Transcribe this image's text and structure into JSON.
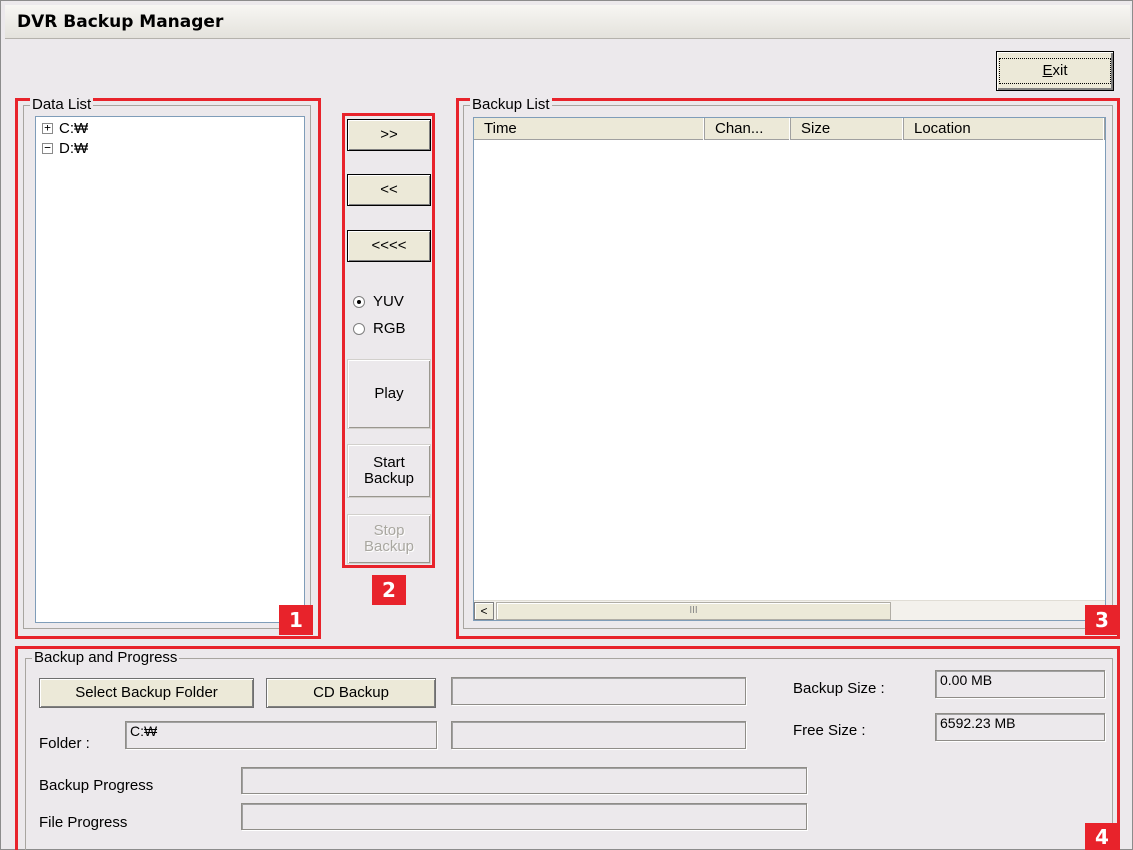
{
  "window": {
    "title": "DVR Backup Manager"
  },
  "exit_button": {
    "label": "Exit"
  },
  "data_list": {
    "legend": "Data List",
    "items": [
      {
        "label": "C:₩",
        "expander": "+"
      },
      {
        "label": "D:₩",
        "expander": "−"
      }
    ]
  },
  "controls": {
    "add_label": ">>",
    "remove_label": "<<",
    "remove_all_label": "<<<<",
    "radio_yuv": "YUV",
    "radio_rgb": "RGB",
    "play_label": "Play",
    "start_backup_line1": "Start",
    "start_backup_line2": "Backup",
    "stop_backup_line1": "Stop",
    "stop_backup_line2": "Backup"
  },
  "backup_list": {
    "legend": "Backup List",
    "columns": [
      "Time",
      "Chan...",
      "Size",
      "Location"
    ],
    "scrollbar_grip": "III",
    "scroll_left": "<"
  },
  "progress": {
    "legend": "Backup and Progress",
    "select_folder_label": "Select Backup Folder",
    "cd_backup_label": "CD Backup",
    "folder_label": "Folder :",
    "folder_value": "C:₩",
    "backup_size_label": "Backup Size :",
    "backup_size_value": "0.00 MB",
    "free_size_label": "Free Size :",
    "free_size_value": "6592.23 MB",
    "backup_progress_label": "Backup Progress",
    "file_progress_label": "File Progress"
  },
  "annotations": {
    "badge1": "1",
    "badge2": "2",
    "badge3": "3",
    "badge4": "4"
  }
}
